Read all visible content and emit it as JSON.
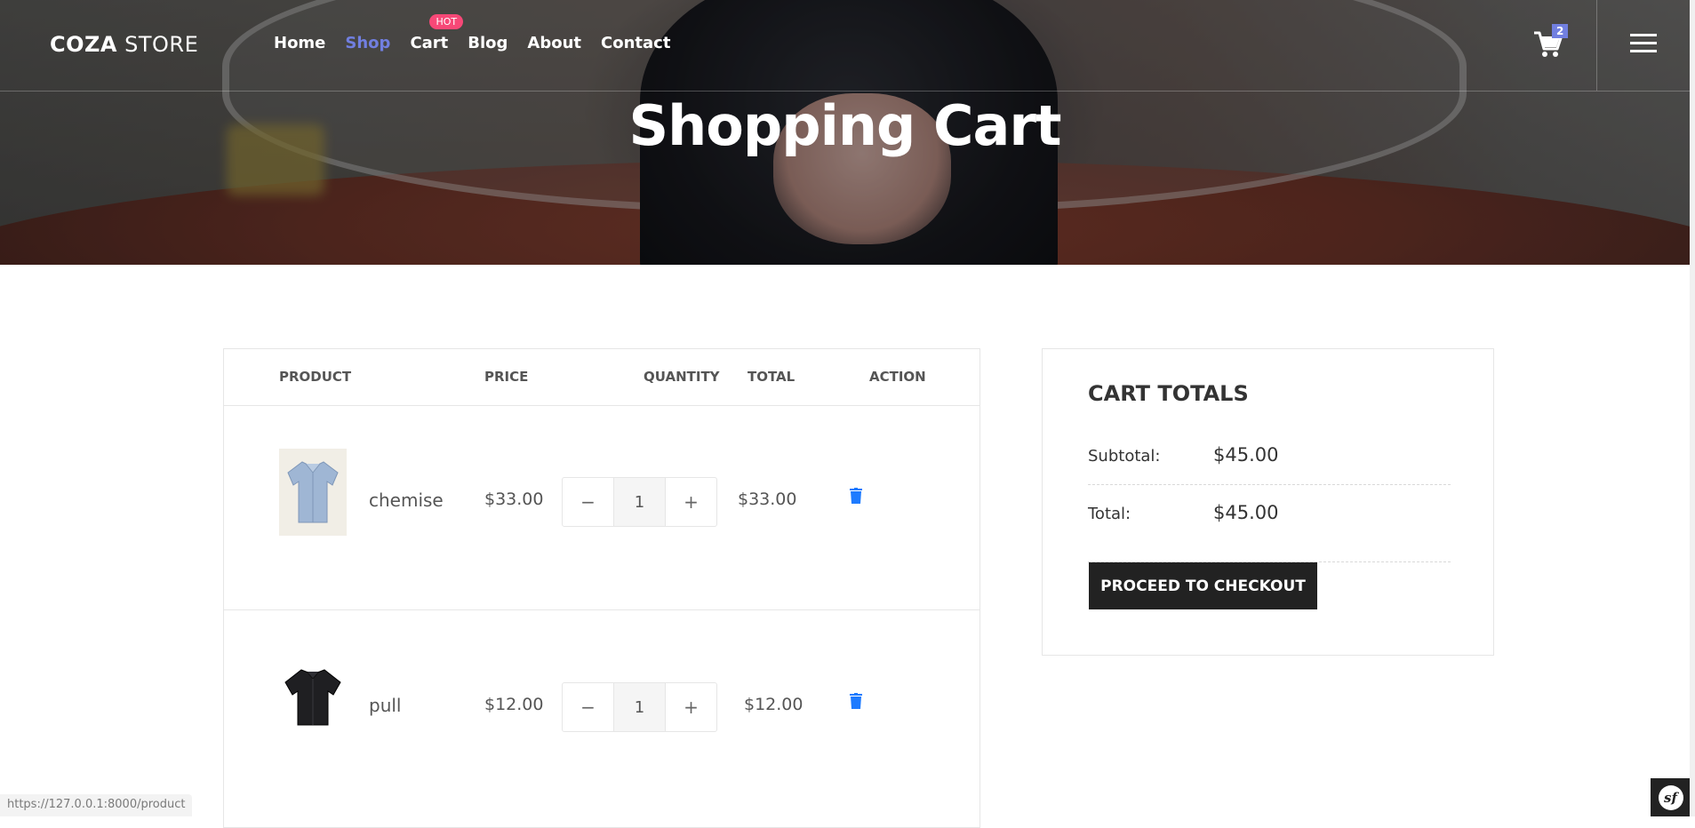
{
  "brand": {
    "logo_bold": "COZA",
    "logo_light": "STORE"
  },
  "nav": {
    "items": [
      {
        "label": "Home",
        "active": false
      },
      {
        "label": "Shop",
        "active": true
      },
      {
        "label": "Cart",
        "active": false,
        "badge": "HOT"
      },
      {
        "label": "Blog",
        "active": false
      },
      {
        "label": "About",
        "active": false
      },
      {
        "label": "Contact",
        "active": false
      }
    ],
    "cart_count": "2",
    "accent_color": "#717fe0",
    "badge_color": "#f74877"
  },
  "hero": {
    "title": "Shopping Cart"
  },
  "cart_table": {
    "headers": {
      "product": "PRODUCT",
      "price": "PRICE",
      "quantity": "QUANTITY",
      "total": "TOTAL",
      "action": "ACTION"
    },
    "rows": [
      {
        "name": "chemise",
        "price": "$33.00",
        "quantity": "1",
        "total": "$33.00",
        "image_icon": "blue-shirt-icon"
      },
      {
        "name": "pull",
        "price": "$12.00",
        "quantity": "1",
        "total": "$12.00",
        "image_icon": "black-shirt-icon"
      }
    ],
    "qty_minus": "−",
    "qty_plus": "+"
  },
  "cart_totals": {
    "title": "CART TOTALS",
    "subtotal_label": "Subtotal:",
    "subtotal_value": "$45.00",
    "total_label": "Total:",
    "total_value": "$45.00",
    "checkout_label": "PROCEED TO CHECKOUT"
  },
  "status_bar": {
    "url": "https://127.0.0.1:8000/product"
  },
  "debug_toolbar": {
    "label": "sf"
  }
}
